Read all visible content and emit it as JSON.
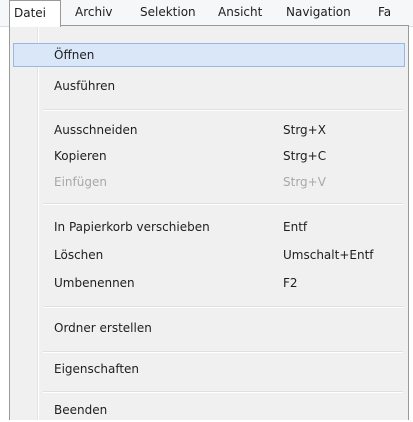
{
  "menubar": {
    "items": [
      {
        "label": "Datei"
      },
      {
        "label": "Archiv"
      },
      {
        "label": "Selektion"
      },
      {
        "label": "Ansicht"
      },
      {
        "label": "Navigation"
      },
      {
        "label": "Fa"
      }
    ]
  },
  "menu": {
    "open": "open",
    "run": "Ausführen",
    "cut": {
      "label": "Ausschneiden",
      "shortcut": "Strg+X"
    },
    "copy": {
      "label": "Kopieren",
      "shortcut": "Strg+C"
    },
    "paste": {
      "label": "Einfügen",
      "shortcut": "Strg+V",
      "disabled": true
    },
    "recycle": {
      "label": "In Papierkorb verschieben",
      "shortcut": "Entf"
    },
    "delete": {
      "label": "Löschen",
      "shortcut": "Umschalt+Entf"
    },
    "rename": {
      "label": "Umbenennen",
      "shortcut": "F2"
    },
    "new_folder": "Ordner erstellen",
    "properties": "Eigenschaften",
    "exit": "Beenden"
  }
}
